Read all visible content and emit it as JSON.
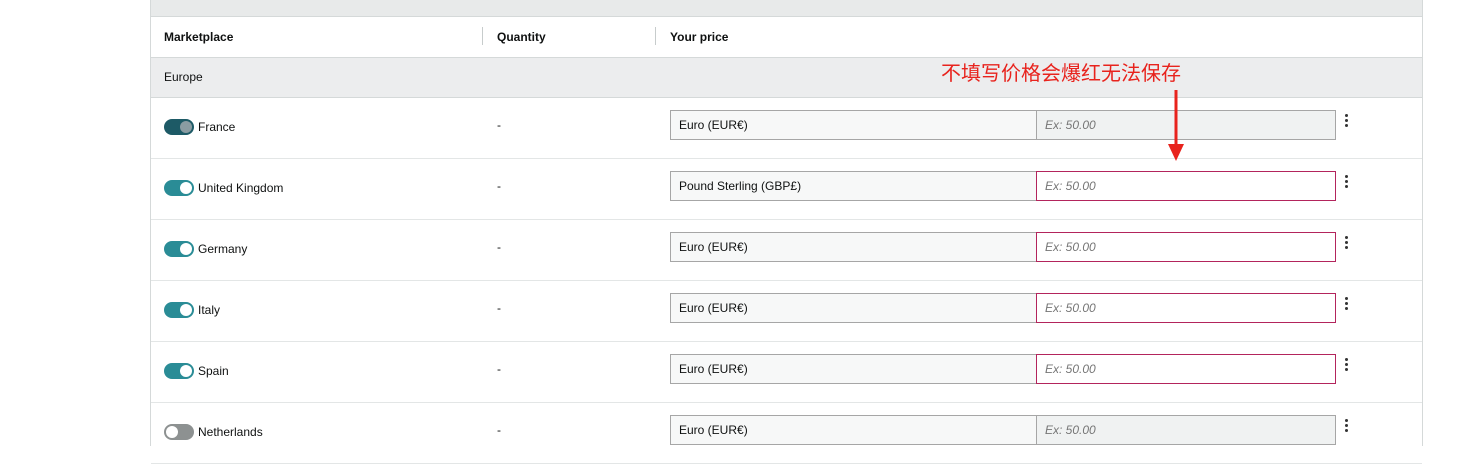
{
  "table": {
    "headers": {
      "marketplace": "Marketplace",
      "quantity": "Quantity",
      "price": "Your price"
    },
    "group_label": "Europe",
    "rows": [
      {
        "country": "France",
        "toggle": "on-dim",
        "quantity": "-",
        "currency": "Euro (EUR€)",
        "price_placeholder": "Ex: 50.00",
        "price_state": "disabled"
      },
      {
        "country": "United Kingdom",
        "toggle": "on",
        "quantity": "-",
        "currency": "Pound Sterling (GBP£)",
        "price_placeholder": "Ex: 50.00",
        "price_state": "error"
      },
      {
        "country": "Germany",
        "toggle": "on",
        "quantity": "-",
        "currency": "Euro (EUR€)",
        "price_placeholder": "Ex: 50.00",
        "price_state": "error"
      },
      {
        "country": "Italy",
        "toggle": "on",
        "quantity": "-",
        "currency": "Euro (EUR€)",
        "price_placeholder": "Ex: 50.00",
        "price_state": "error"
      },
      {
        "country": "Spain",
        "toggle": "on",
        "quantity": "-",
        "currency": "Euro (EUR€)",
        "price_placeholder": "Ex: 50.00",
        "price_state": "error"
      },
      {
        "country": "Netherlands",
        "toggle": "off",
        "quantity": "-",
        "currency": "Euro (EUR€)",
        "price_placeholder": "Ex: 50.00",
        "price_state": "disabled"
      }
    ]
  },
  "annotation": {
    "text": "不填写价格会爆红无法保存",
    "color": "#e8231d"
  },
  "colors": {
    "toggle_on": "#2a8c96",
    "toggle_off": "#8d9191",
    "error_border": "#b3245c"
  }
}
